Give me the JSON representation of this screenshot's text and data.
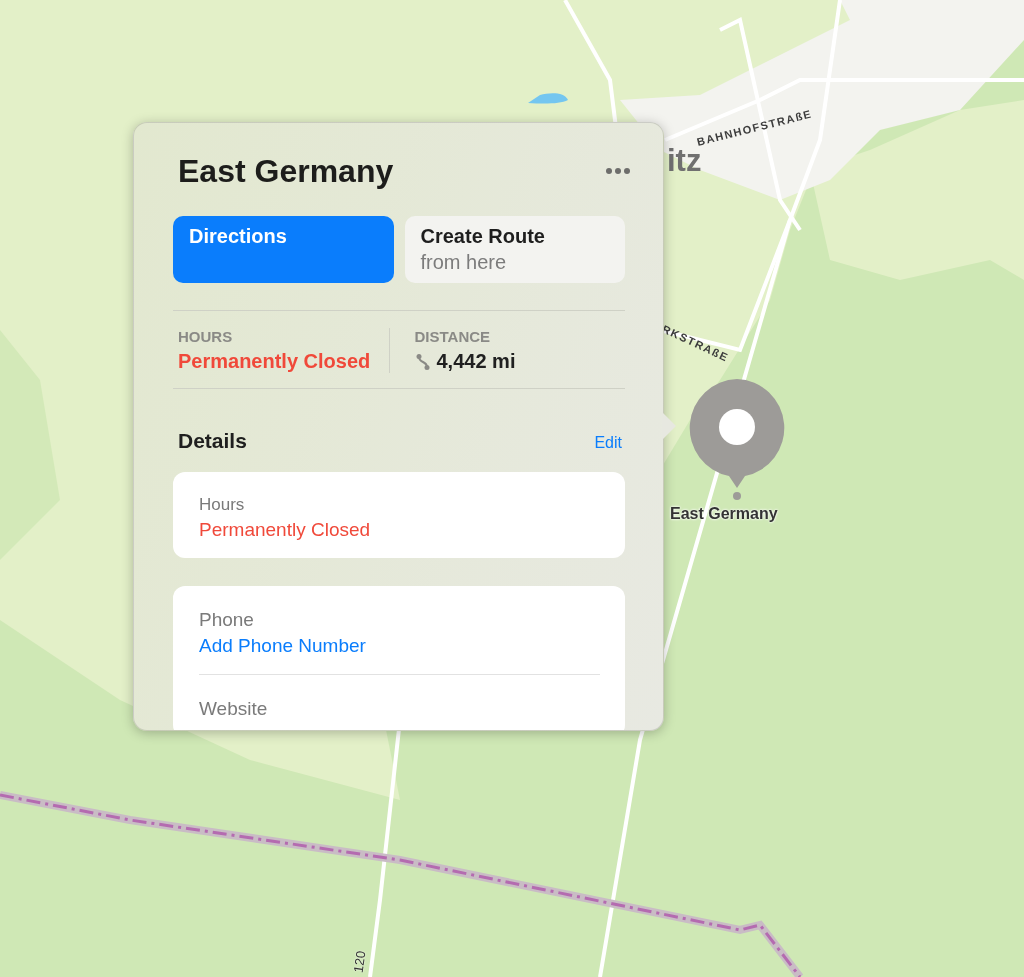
{
  "map": {
    "labels": [
      {
        "kind": "street",
        "text": "BAHNHOFSTRAßE"
      },
      {
        "kind": "town",
        "text": "itz"
      },
      {
        "kind": "street",
        "text": "RKSTRAßE"
      },
      {
        "kind": "route",
        "text": "120"
      }
    ],
    "pin": {
      "label": "East Germany"
    }
  },
  "place": {
    "title": "East Germany",
    "buttons": [
      {
        "kind": "primary",
        "label": "Directions"
      },
      {
        "kind": "secondary",
        "label": "Create Route",
        "sublabel": "from here"
      }
    ],
    "info": [
      {
        "kind": "status",
        "heading": "HOURS",
        "value": "Permanently Closed"
      },
      {
        "kind": "distance",
        "heading": "DISTANCE",
        "value": "4,442 mi"
      }
    ],
    "details": {
      "title": "Details",
      "action": "Edit",
      "cards": [
        [
          {
            "kind": "status",
            "label": "Hours",
            "value": "Permanently Closed"
          }
        ],
        [
          {
            "kind": "link",
            "label": "Phone",
            "value": "Add Phone Number"
          },
          {
            "label": "Website"
          }
        ]
      ]
    }
  }
}
